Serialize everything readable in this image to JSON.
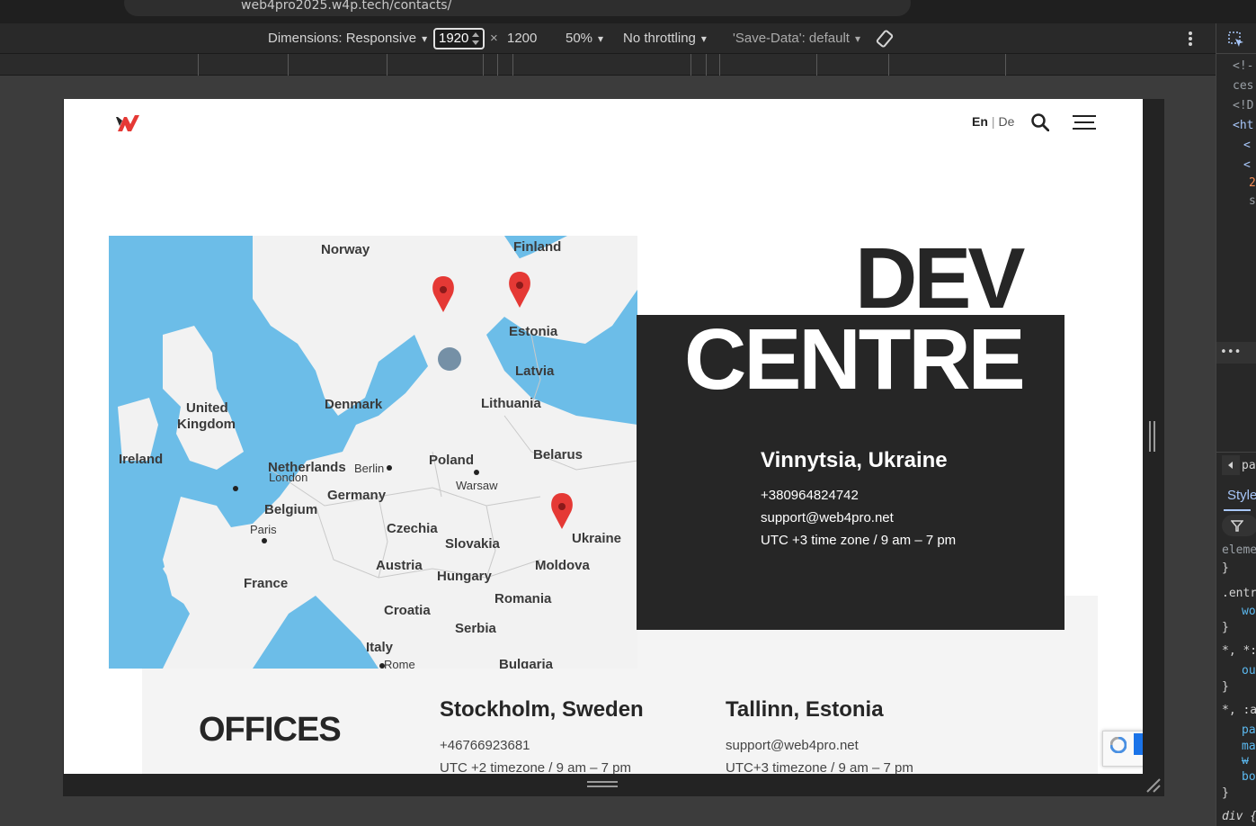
{
  "browser": {
    "url": "web4pro2025.w4p.tech/contacts/"
  },
  "device_toolbar": {
    "dimensions_label": "Dimensions: Responsive",
    "width": "1920",
    "times": "×",
    "height": "1200",
    "zoom": "50%",
    "throttling": "No throttling",
    "save_data": "'Save-Data': default"
  },
  "site": {
    "lang_en": "En",
    "lang_sep": "|",
    "lang_de": "De",
    "title_line1": "DEV",
    "title_line2": "CENTRE",
    "main_office": {
      "city": "Vinnytsia, Ukraine",
      "phone": "+380964824742",
      "email": "support@web4pro.net",
      "hours": "UTC +3 time zone / 9 am – 7 pm"
    },
    "offices_heading": "OFFICES",
    "offices": [
      {
        "city": "Stockholm, Sweden",
        "line1": "+46766923681",
        "line2": "UTC +2 timezone / 9 am – 7 pm"
      },
      {
        "city": "Tallinn, Estonia",
        "line1": "support@web4pro.net",
        "line2": "UTC+3 timezone / 9 am – 7 pm"
      }
    ]
  },
  "map": {
    "labels": [
      "Norway",
      "Finland",
      "Estonia",
      "Latvia",
      "Lithuania",
      "Denmark",
      "United",
      "Kingdom",
      "Ireland",
      "London",
      "Netherlands",
      "Berlin",
      "Poland",
      "Warsaw",
      "Belarus",
      "Germany",
      "Belgium",
      "Paris",
      "Czechia",
      "Slovakia",
      "Ukraine",
      "Moldova",
      "Austria",
      "Hungary",
      "Romania",
      "France",
      "Croatia",
      "Serbia",
      "Italy",
      "Rome",
      "Bulgaria"
    ]
  },
  "devtools": {
    "lines": [
      "<!-",
      "ces",
      "<!D",
      "<ht",
      "<",
      "<",
      "2",
      "s"
    ],
    "panel_tab": "pa",
    "styles_tab": "Style",
    "rules": [
      "eleme",
      "}",
      ".entr",
      "wo",
      "}",
      "*, *:",
      "ou",
      "}",
      "*, :a",
      "pa",
      "ma",
      "w",
      "bo",
      "}",
      "div {"
    ]
  },
  "colors": {
    "dark": "#262626",
    "accent_red": "#e53935",
    "map_water": "#6cbde8",
    "map_land": "#f2f2f2"
  }
}
